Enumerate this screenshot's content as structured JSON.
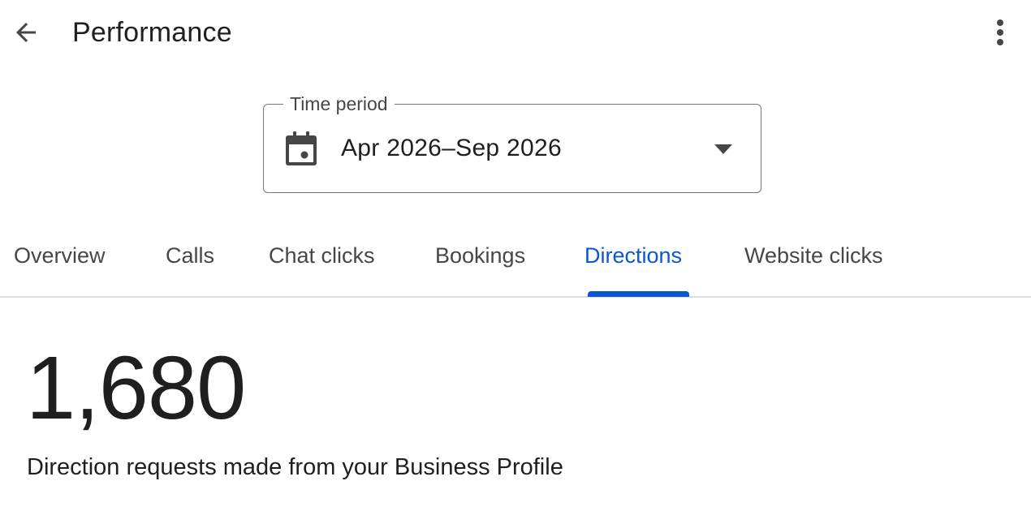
{
  "header": {
    "title": "Performance",
    "back_icon": "arrow-back-icon",
    "more_icon": "more-vert-icon"
  },
  "time_period": {
    "label": "Time period",
    "value": "Apr 2026–Sep 2026",
    "icon": "calendar-icon",
    "dropdown_icon": "arrow-drop-down-icon"
  },
  "tabs": [
    {
      "label": "Overview",
      "active": false
    },
    {
      "label": "Calls",
      "active": false
    },
    {
      "label": "Chat clicks",
      "active": false
    },
    {
      "label": "Bookings",
      "active": false
    },
    {
      "label": "Directions",
      "active": true
    },
    {
      "label": "Website clicks",
      "active": false
    }
  ],
  "metric": {
    "value": "1,680",
    "caption": "Direction requests made from your Business Profile"
  },
  "colors": {
    "accent": "#0b57d0",
    "text_primary": "#1f1f1f",
    "text_secondary": "#444746",
    "outline": "#747775",
    "divider": "#dadce0"
  }
}
